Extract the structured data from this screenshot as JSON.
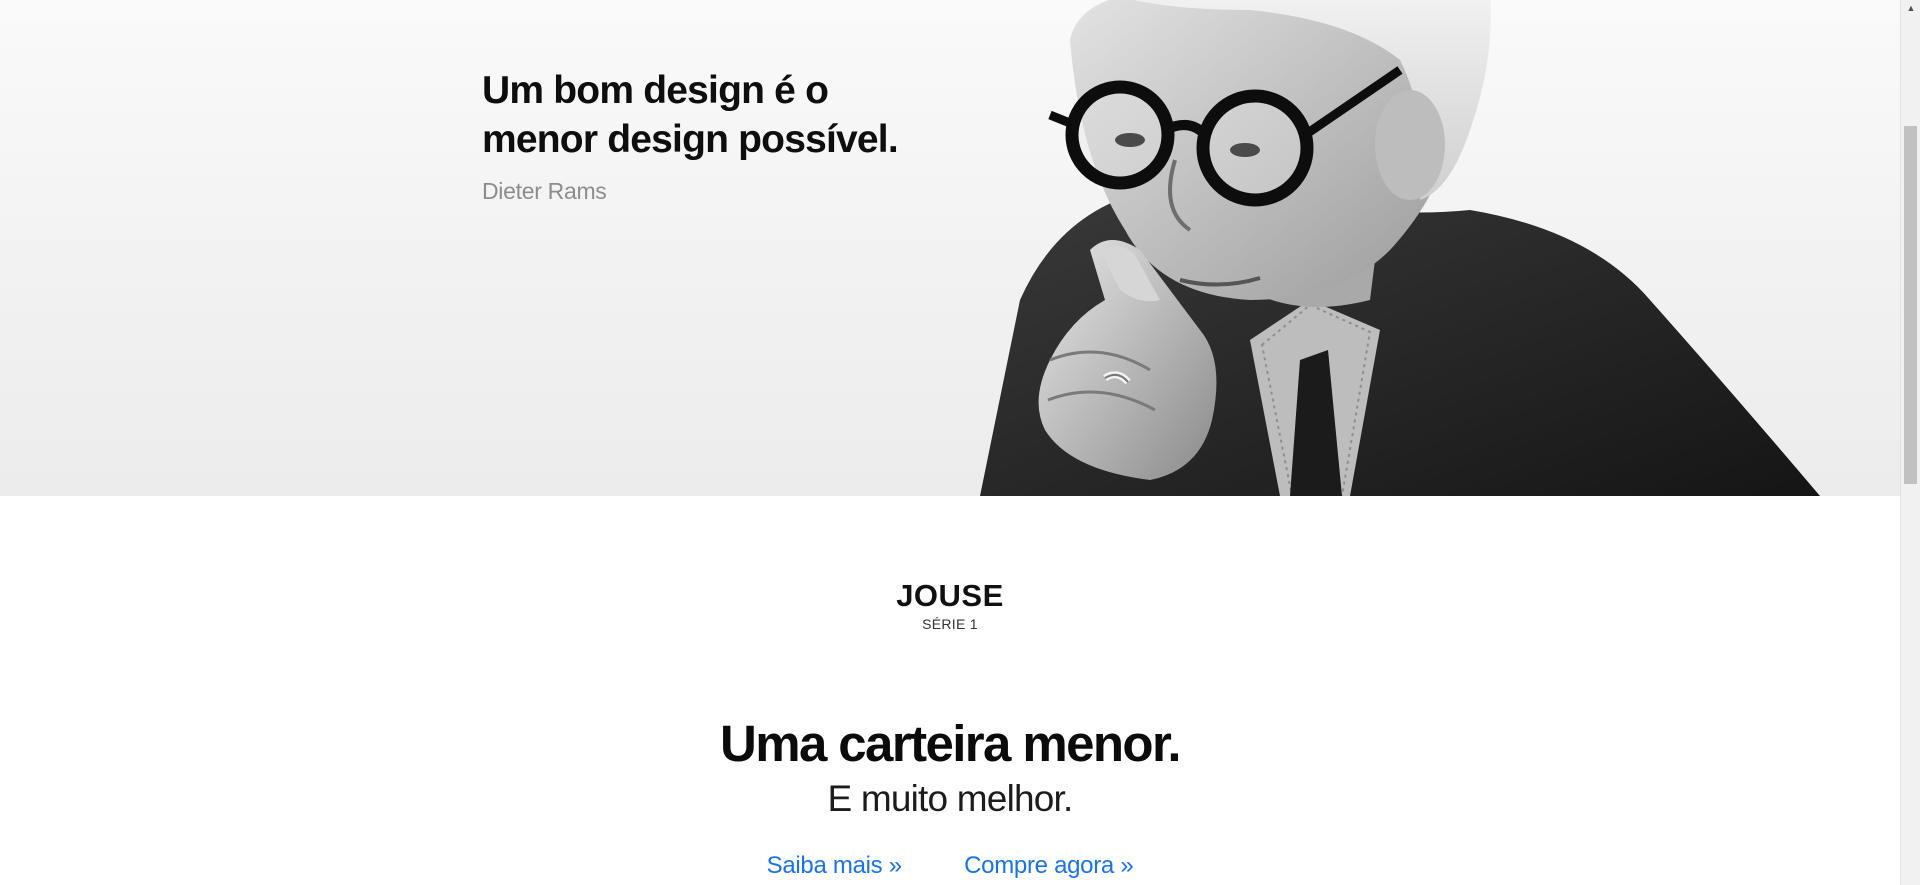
{
  "hero": {
    "quote": "Um bom design é o menor design possível.",
    "author": "Dieter Rams",
    "portrait_icon": "portrait-photo"
  },
  "product": {
    "brand": "JOUSE",
    "series": "SÉRIE 1",
    "headline": "Uma carteira menor.",
    "subheadline": "E muito melhor.",
    "link_learn_more": "Saiba mais »",
    "link_buy_now": "Compre agora »"
  },
  "colors": {
    "link": "#1a73e8",
    "hero_bg": "#f1f1f1",
    "author_text": "#8d8d8d"
  },
  "scrollbar": {
    "up_icon": "chevron-up-icon"
  }
}
